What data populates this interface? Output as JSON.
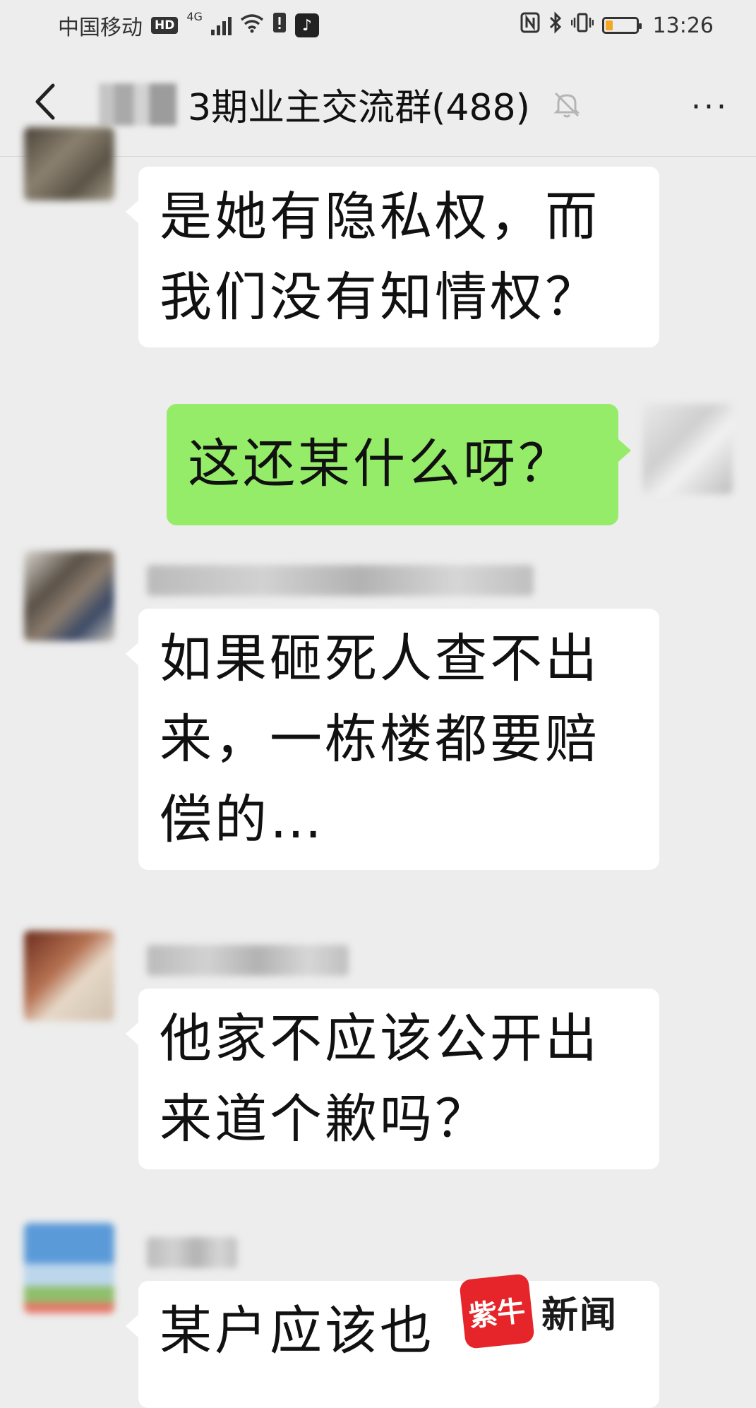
{
  "status_bar": {
    "carrier": "中国移动",
    "hd_badge": "HD",
    "network": "4G",
    "time": "13:26"
  },
  "header": {
    "title": "3期业主交流群(488)",
    "more_label": "···"
  },
  "messages": [
    {
      "side": "left",
      "text_lines": [
        "是她有隐私权，而",
        "我们没有知情权？"
      ]
    },
    {
      "side": "right",
      "text_lines": [
        "这还某什么呀？"
      ]
    },
    {
      "side": "left",
      "text_lines": [
        "如果砸死人查不出",
        "来，一栋楼都要赔",
        "偿的…"
      ]
    },
    {
      "side": "left",
      "text_lines": [
        "他家不应该公开出",
        "来道个歉吗？"
      ]
    },
    {
      "side": "left",
      "text_lines": [
        "某户应该也"
      ]
    }
  ],
  "watermark": {
    "logo_text": "紫牛",
    "brand": "新闻"
  },
  "colors": {
    "background": "#ededed",
    "bubble_left": "#ffffff",
    "bubble_right": "#95ec69",
    "watermark_red": "#e5252a"
  }
}
